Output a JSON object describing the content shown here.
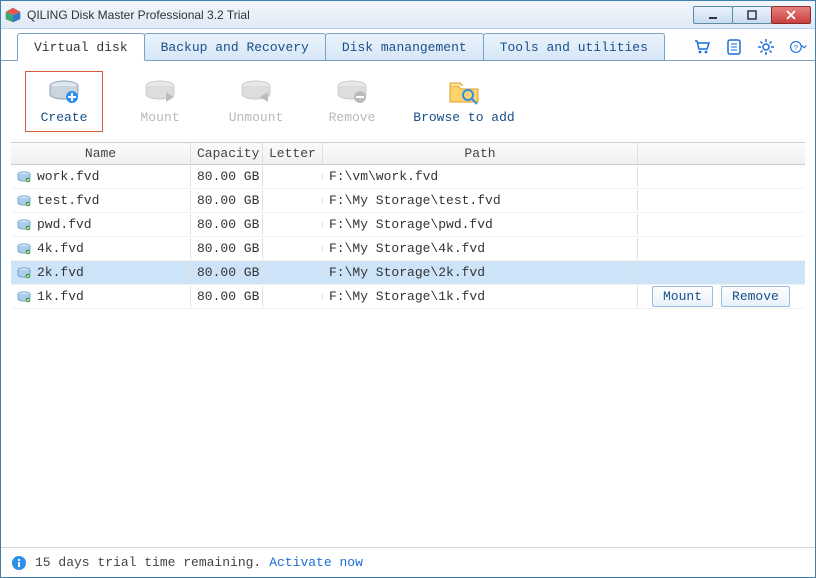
{
  "title": "QILING Disk Master Professional 3.2 Trial",
  "tabs": [
    {
      "label": "Virtual disk",
      "active": true
    },
    {
      "label": "Backup and Recovery",
      "active": false
    },
    {
      "label": "Disk manangement",
      "active": false
    },
    {
      "label": "Tools and utilities",
      "active": false
    }
  ],
  "toolbar": {
    "create": "Create",
    "mount": "Mount",
    "unmount": "Unmount",
    "remove": "Remove",
    "browse": "Browse to add"
  },
  "columns": {
    "name": "Name",
    "capacity": "Capacity",
    "letter": "Letter",
    "path": "Path"
  },
  "rows": [
    {
      "name": "work.fvd",
      "capacity": "80.00 GB",
      "letter": "",
      "path": "F:\\vm\\work.fvd",
      "selected": false,
      "showActions": false
    },
    {
      "name": "test.fvd",
      "capacity": "80.00 GB",
      "letter": "",
      "path": "F:\\My Storage\\test.fvd",
      "selected": false,
      "showActions": false
    },
    {
      "name": "pwd.fvd",
      "capacity": "80.00 GB",
      "letter": "",
      "path": "F:\\My Storage\\pwd.fvd",
      "selected": false,
      "showActions": false
    },
    {
      "name": "4k.fvd",
      "capacity": "80.00 GB",
      "letter": "",
      "path": "F:\\My Storage\\4k.fvd",
      "selected": false,
      "showActions": false
    },
    {
      "name": "2k.fvd",
      "capacity": "80.00 GB",
      "letter": "",
      "path": "F:\\My Storage\\2k.fvd",
      "selected": true,
      "showActions": false
    },
    {
      "name": "1k.fvd",
      "capacity": "80.00 GB",
      "letter": "",
      "path": "F:\\My Storage\\1k.fvd",
      "selected": false,
      "showActions": true
    }
  ],
  "rowActions": {
    "mount": "Mount",
    "remove": "Remove"
  },
  "status": {
    "text": "15 days trial time remaining. ",
    "link": "Activate now"
  }
}
